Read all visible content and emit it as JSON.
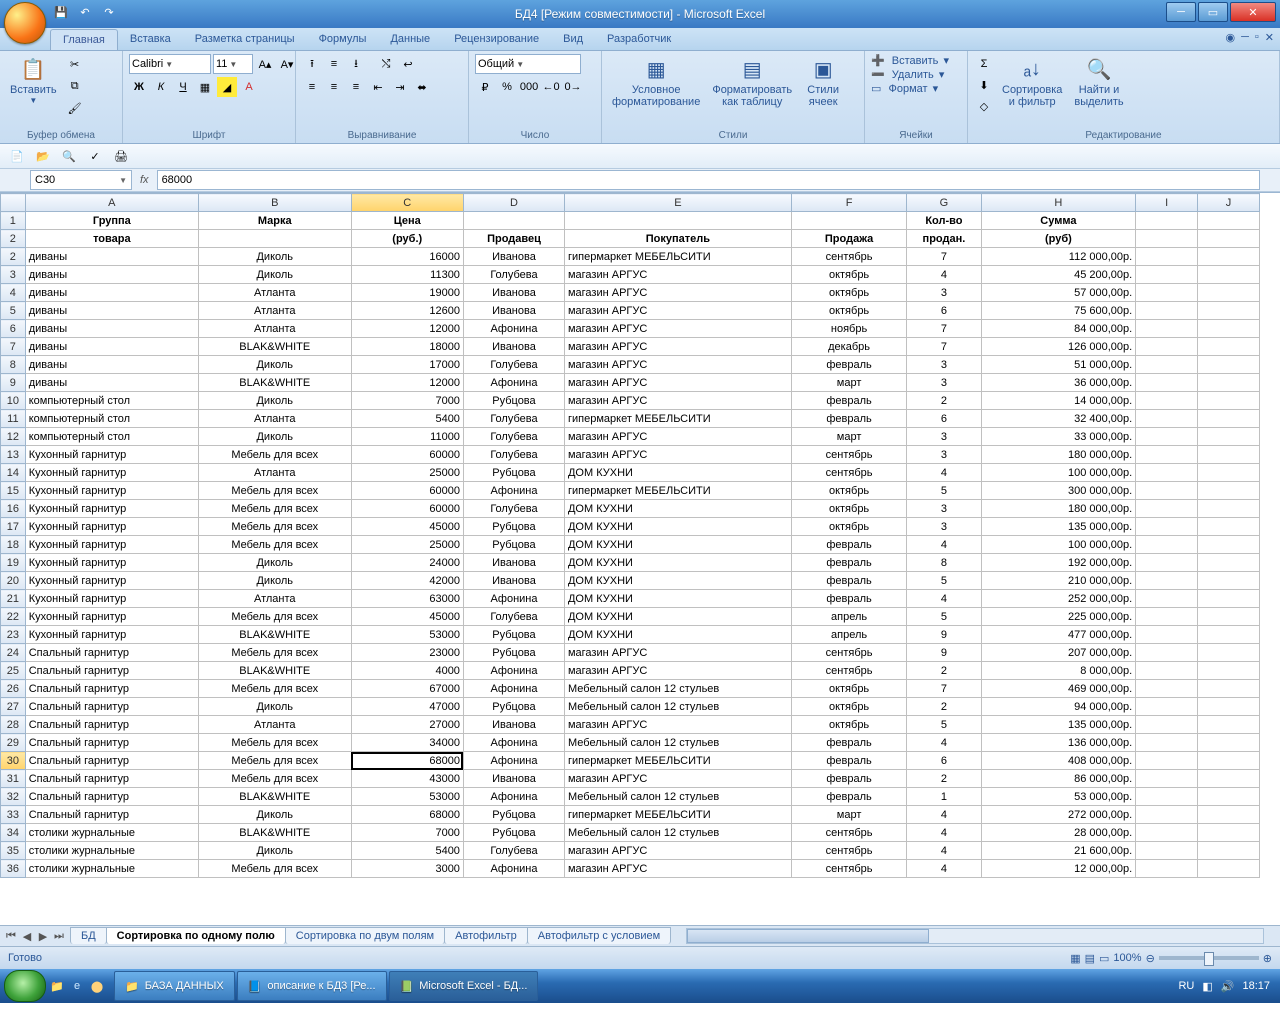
{
  "window_title": "БД4  [Режим совместимости] - Microsoft Excel",
  "ribbon": {
    "tabs": [
      "Главная",
      "Вставка",
      "Разметка страницы",
      "Формулы",
      "Данные",
      "Рецензирование",
      "Вид",
      "Разработчик"
    ],
    "active_tab": 0,
    "clipboard": {
      "paste": "Вставить",
      "label": "Буфер обмена"
    },
    "font": {
      "name": "Calibri",
      "size": "11",
      "label": "Шрифт"
    },
    "alignment": {
      "label": "Выравнивание"
    },
    "number": {
      "format": "Общий",
      "label": "Число"
    },
    "styles": {
      "cond": "Условное\nформатирование",
      "table": "Форматировать\nкак таблицу",
      "cell": "Стили\nячеек",
      "label": "Стили"
    },
    "cells": {
      "insert": "Вставить",
      "delete": "Удалить",
      "format": "Формат",
      "label": "Ячейки"
    },
    "editing": {
      "sort": "Сортировка\nи фильтр",
      "find": "Найти и\nвыделить",
      "label": "Редактирование"
    }
  },
  "namebox": "C30",
  "formula": "68000",
  "columns": [
    "A",
    "B",
    "C",
    "D",
    "E",
    "F",
    "G",
    "H",
    "I",
    "J"
  ],
  "selected_col_idx": 2,
  "selected_row": 30,
  "headers": {
    "r1": [
      "Группа",
      "Марка",
      "Цена",
      "",
      "",
      "",
      "Кол-во",
      "Сумма"
    ],
    "r2": [
      "товара",
      "",
      "(руб.)",
      "Продавец",
      "Покупатель",
      "Продажа",
      "продан.",
      "(руб)"
    ]
  },
  "rows": [
    [
      "диваны",
      "Диколь",
      "16000",
      "Иванова",
      "гипермаркет МЕБЕЛЬСИТИ",
      "сентябрь",
      "7",
      "112 000,00р."
    ],
    [
      "диваны",
      "Диколь",
      "11300",
      "Голубева",
      "магазин АРГУС",
      "октябрь",
      "4",
      "45 200,00р."
    ],
    [
      "диваны",
      "Атланта",
      "19000",
      "Иванова",
      "магазин АРГУС",
      "октябрь",
      "3",
      "57 000,00р."
    ],
    [
      "диваны",
      "Атланта",
      "12600",
      "Иванова",
      "магазин АРГУС",
      "октябрь",
      "6",
      "75 600,00р."
    ],
    [
      "диваны",
      "Атланта",
      "12000",
      "Афонина",
      "магазин АРГУС",
      "ноябрь",
      "7",
      "84 000,00р."
    ],
    [
      "диваны",
      "BLAK&WHITE",
      "18000",
      "Иванова",
      "магазин АРГУС",
      "декабрь",
      "7",
      "126 000,00р."
    ],
    [
      "диваны",
      "Диколь",
      "17000",
      "Голубева",
      "магазин АРГУС",
      "февраль",
      "3",
      "51 000,00р."
    ],
    [
      "диваны",
      "BLAK&WHITE",
      "12000",
      "Афонина",
      "магазин АРГУС",
      "март",
      "3",
      "36 000,00р."
    ],
    [
      "компьютерный стол",
      "Диколь",
      "7000",
      "Рубцова",
      "магазин АРГУС",
      "февраль",
      "2",
      "14 000,00р."
    ],
    [
      "компьютерный стол",
      "Атланта",
      "5400",
      "Голубева",
      "гипермаркет МЕБЕЛЬСИТИ",
      "февраль",
      "6",
      "32 400,00р."
    ],
    [
      "компьютерный стол",
      "Диколь",
      "11000",
      "Голубева",
      "магазин АРГУС",
      "март",
      "3",
      "33 000,00р."
    ],
    [
      "Кухонный гарнитур",
      "Мебель для всех",
      "60000",
      "Голубева",
      "магазин АРГУС",
      "сентябрь",
      "3",
      "180 000,00р."
    ],
    [
      "Кухонный гарнитур",
      "Атланта",
      "25000",
      "Рубцова",
      "ДОМ КУХНИ",
      "сентябрь",
      "4",
      "100 000,00р."
    ],
    [
      "Кухонный гарнитур",
      "Мебель для всех",
      "60000",
      "Афонина",
      "гипермаркет МЕБЕЛЬСИТИ",
      "октябрь",
      "5",
      "300 000,00р."
    ],
    [
      "Кухонный гарнитур",
      "Мебель для всех",
      "60000",
      "Голубева",
      "ДОМ КУХНИ",
      "октябрь",
      "3",
      "180 000,00р."
    ],
    [
      "Кухонный гарнитур",
      "Мебель для всех",
      "45000",
      "Рубцова",
      "ДОМ КУХНИ",
      "октябрь",
      "3",
      "135 000,00р."
    ],
    [
      "Кухонный гарнитур",
      "Мебель для всех",
      "25000",
      "Рубцова",
      "ДОМ КУХНИ",
      "февраль",
      "4",
      "100 000,00р."
    ],
    [
      "Кухонный гарнитур",
      "Диколь",
      "24000",
      "Иванова",
      "ДОМ КУХНИ",
      "февраль",
      "8",
      "192 000,00р."
    ],
    [
      "Кухонный гарнитур",
      "Диколь",
      "42000",
      "Иванова",
      "ДОМ КУХНИ",
      "февраль",
      "5",
      "210 000,00р."
    ],
    [
      "Кухонный гарнитур",
      "Атланта",
      "63000",
      "Афонина",
      "ДОМ КУХНИ",
      "февраль",
      "4",
      "252 000,00р."
    ],
    [
      "Кухонный гарнитур",
      "Мебель для всех",
      "45000",
      "Голубева",
      "ДОМ КУХНИ",
      "апрель",
      "5",
      "225 000,00р."
    ],
    [
      "Кухонный гарнитур",
      "BLAK&WHITE",
      "53000",
      "Рубцова",
      "ДОМ КУХНИ",
      "апрель",
      "9",
      "477 000,00р."
    ],
    [
      "Спальный гарнитур",
      "Мебель для всех",
      "23000",
      "Рубцова",
      "магазин АРГУС",
      "сентябрь",
      "9",
      "207 000,00р."
    ],
    [
      "Спальный гарнитур",
      "BLAK&WHITE",
      "4000",
      "Афонина",
      "магазин АРГУС",
      "сентябрь",
      "2",
      "8 000,00р."
    ],
    [
      "Спальный гарнитур",
      "Мебель для всех",
      "67000",
      "Афонина",
      "Мебельный салон 12 стульев",
      "октябрь",
      "7",
      "469 000,00р."
    ],
    [
      "Спальный гарнитур",
      "Диколь",
      "47000",
      "Рубцова",
      "Мебельный салон 12 стульев",
      "октябрь",
      "2",
      "94 000,00р."
    ],
    [
      "Спальный гарнитур",
      "Атланта",
      "27000",
      "Иванова",
      "магазин АРГУС",
      "октябрь",
      "5",
      "135 000,00р."
    ],
    [
      "Спальный гарнитур",
      "Мебель для всех",
      "34000",
      "Афонина",
      "Мебельный салон 12 стульев",
      "февраль",
      "4",
      "136 000,00р."
    ],
    [
      "Спальный гарнитур",
      "Мебель для всех",
      "68000",
      "Афонина",
      "гипермаркет МЕБЕЛЬСИТИ",
      "февраль",
      "6",
      "408 000,00р."
    ],
    [
      "Спальный гарнитур",
      "Мебель для всех",
      "43000",
      "Иванова",
      "магазин АРГУС",
      "февраль",
      "2",
      "86 000,00р."
    ],
    [
      "Спальный гарнитур",
      "BLAK&WHITE",
      "53000",
      "Афонина",
      "Мебельный салон 12 стульев",
      "февраль",
      "1",
      "53 000,00р."
    ],
    [
      "Спальный гарнитур",
      "Диколь",
      "68000",
      "Рубцова",
      "гипермаркет МЕБЕЛЬСИТИ",
      "март",
      "4",
      "272 000,00р."
    ],
    [
      "столики журнальные",
      "BLAK&WHITE",
      "7000",
      "Рубцова",
      "Мебельный салон 12 стульев",
      "сентябрь",
      "4",
      "28 000,00р."
    ],
    [
      "столики журнальные",
      "Диколь",
      "5400",
      "Голубева",
      "магазин АРГУС",
      "сентябрь",
      "4",
      "21 600,00р."
    ],
    [
      "столики журнальные",
      "Мебель для всех",
      "3000",
      "Афонина",
      "магазин АРГУС",
      "сентябрь",
      "4",
      "12 000,00р."
    ]
  ],
  "blank_row_after": 33,
  "sheet_tabs": [
    "БД",
    "Сортировка по одному полю",
    "Сортировка по двум полям",
    "Автофильтр",
    "Автофильтр с условием"
  ],
  "active_sheet": 1,
  "status": "Готово",
  "zoom": "100%",
  "lang": "RU",
  "clock": "18:17",
  "taskbar": {
    "items": [
      "БАЗА ДАННЫХ",
      "описание к БД3 [Ре...",
      "Microsoft Excel - БД..."
    ]
  }
}
